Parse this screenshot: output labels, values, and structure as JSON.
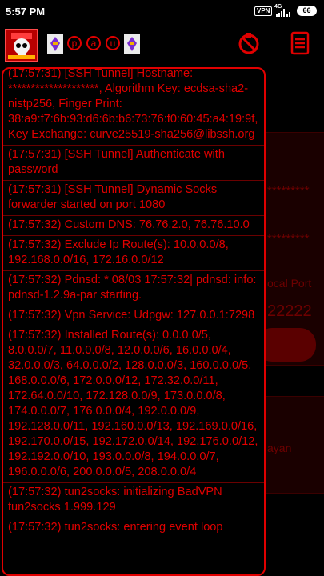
{
  "status_bar": {
    "time": "5:57 PM",
    "vpn_label": "VPN",
    "network_type": "4G",
    "battery": "66"
  },
  "toolbar": {
    "letters": [
      "p",
      "a",
      "u"
    ]
  },
  "background": {
    "password_mask": "*********",
    "local_port_label": "ocal Port",
    "local_port_value": "22222",
    "partial_text": "ayan"
  },
  "log": {
    "entries": [
      "(17:57:31) [SSH Tunnel] Hostname: ********************, Algorithm Key: ecdsa-sha2-nistp256, Finger Print: 38:a9:f7:6b:93:d6:6b:b6:73:76:f0:60:45:a4:19:9f, Key Exchange: curve25519-sha256@libssh.org",
      "(17:57:31) [SSH Tunnel] Authenticate with password",
      "(17:57:31) [SSH Tunnel] Dynamic Socks forwarder started on port 1080",
      "(17:57:32) Custom DNS: 76.76.2.0, 76.76.10.0",
      "(17:57:32) Exclude Ip Route(s): 10.0.0.0/8, 192.168.0.0/16, 172.16.0.0/12",
      "(17:57:32) Pdnsd: * 08/03 17:57:32| pdnsd: info: pdnsd-1.2.9a-par starting.",
      "(17:57:32) Vpn Service: Udpgw: 127.0.0.1:7298",
      "(17:57:32) Installed Route(s): 0.0.0.0/5, 8.0.0.0/7, 11.0.0.0/8, 12.0.0.0/6, 16.0.0.0/4, 32.0.0.0/3, 64.0.0.0/2, 128.0.0.0/3, 160.0.0.0/5, 168.0.0.0/6, 172.0.0.0/12, 172.32.0.0/11, 172.64.0.0/10, 172.128.0.0/9, 173.0.0.0/8, 174.0.0.0/7, 176.0.0.0/4, 192.0.0.0/9, 192.128.0.0/11, 192.160.0.0/13, 192.169.0.0/16, 192.170.0.0/15, 192.172.0.0/14, 192.176.0.0/12, 192.192.0.0/10, 193.0.0.0/8, 194.0.0.0/7, 196.0.0.0/6, 200.0.0.0/5, 208.0.0.0/4",
      "(17:57:32) tun2socks: initializing BadVPN tun2socks 1.999.129",
      "(17:57:32) tun2socks: entering event loop"
    ]
  },
  "colors": {
    "accent": "#e00000",
    "divider": "#6a0000",
    "background": "#000000"
  }
}
